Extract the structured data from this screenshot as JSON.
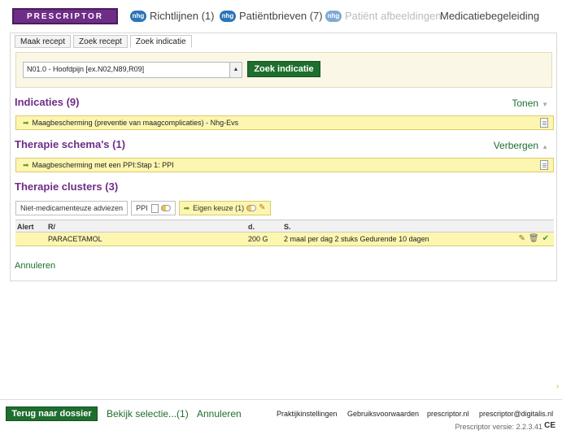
{
  "nav": {
    "logo": "PRESCRIPTOR",
    "items": [
      {
        "badge": "nhg",
        "label": "Richtlijnen (1)"
      },
      {
        "badge": "nhg",
        "label": "Patiëntbrieven (7)"
      },
      {
        "badge": "nhg",
        "label": "Patiënt afbeeldingen",
        "disabled": true
      },
      {
        "label": "Medicatiebegeleiding"
      }
    ]
  },
  "tabs": [
    "Maak recept",
    "Zoek recept",
    "Zoek indicatie"
  ],
  "search": {
    "value": "N01.0 - Hoofdpijn [ex.N02,N89,R09]",
    "button": "Zoek indicatie"
  },
  "indicaties": {
    "title": "Indicaties (9)",
    "toggle": "Tonen",
    "row": "Maagbescherming (preventie van maagcomplicaties) - Nhg-Evs"
  },
  "therapie_schemas": {
    "title": "Therapie schema's (1)",
    "toggle": "Verbergen",
    "row": "Maagbescherming met een PPI:Stap 1: PPI"
  },
  "therapie_clusters": {
    "title": "Therapie clusters (3)",
    "buttons": [
      "Niet-medicamenteuze adviezen",
      "PPI",
      "Eigen keuze (1)"
    ]
  },
  "table": {
    "headers": [
      "Alert",
      "R/",
      "d.",
      "S."
    ],
    "rows": [
      {
        "alert": "",
        "name": "PARACETAMOL",
        "d": "200 G",
        "s": "2 maal per dag 2 stuks Gedurende 10 dagen"
      }
    ]
  },
  "annuleren": "Annuleren",
  "footer": {
    "back": "Terug naar dossier",
    "bekijk": "Bekijk selectie...(1)",
    "annuleren": "Annuleren",
    "links": [
      "Praktijkinstellingen",
      "Gebruiksvoorwaarden",
      "prescriptor.nl",
      "prescriptor@digitalis.nl"
    ],
    "version": "Prescriptor versie: 2.2.3.41",
    "ce": "CE"
  },
  "colors": {
    "accent": "#6e2d86",
    "green": "#1e6e2e",
    "highlight": "#fdf6b0"
  }
}
